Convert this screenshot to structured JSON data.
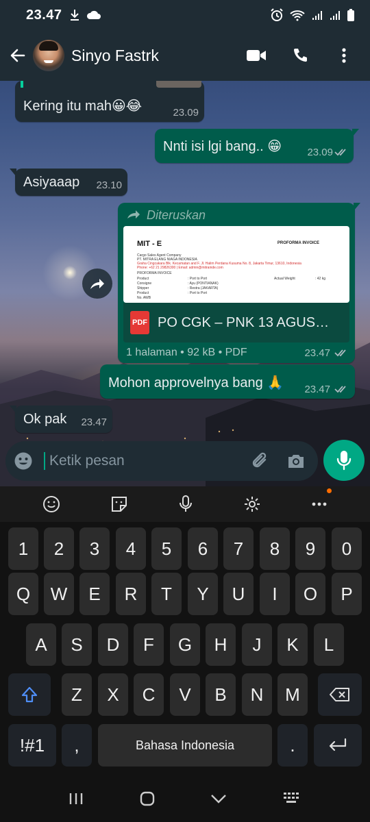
{
  "status_bar": {
    "time": "23.47"
  },
  "header": {
    "contact_name": "Sinyo Fastrk"
  },
  "messages": [
    {
      "direction": "in",
      "text": "Kering itu mah😀😂",
      "time": "23.09"
    },
    {
      "direction": "out",
      "text": "Nnti isi lgi bang.. 😁",
      "time": "23.09"
    },
    {
      "direction": "in",
      "text": "Asiyaaap",
      "time": "23.10"
    },
    {
      "direction": "out",
      "forwarded_label": "Diteruskan",
      "document": {
        "preview": {
          "company_logo": "MIT - E",
          "doc_heading": "PROFORMA INVOICE",
          "lines": [
            "Cargo Sales Agent Company",
            "PT. MITRA ELANG NIAGA INDONESIA",
            "Graha Cingcakara Blk. Kecamatan and F. Jl. Halim Perdana Kusuma No. 8, Jakarta Timur, 13610, Indonesia",
            "Phone: +62 21 29826300 | Email: admin@mitrainde.com",
            "PROFORMA INVOICE"
          ],
          "rows": [
            {
              "label": "Product",
              "value": ": Port to Port",
              "extra_label": "Actual Weight",
              "extra_value": ": 42 kg"
            },
            {
              "label": "Consigne",
              "value": ": Ayu (PONTIANAK)"
            },
            {
              "label": "Shipper",
              "value": ": Restra (JAKARTA)"
            },
            {
              "label": "Product",
              "value": ": Port to Port"
            },
            {
              "label": "No. AWB",
              "value": ""
            }
          ]
        },
        "badge": "PDF",
        "title": "PO CGK – PNK 13 AGUSTUS...",
        "meta": "1 halaman • 92 kB • PDF"
      },
      "time": "23.47"
    },
    {
      "direction": "out",
      "text": "Mohon approvelnya bang 🙏",
      "time": "23.47"
    },
    {
      "direction": "in",
      "text": "Ok pak",
      "time": "23.47"
    }
  ],
  "composer": {
    "placeholder": "Ketik pesan"
  },
  "keyboard": {
    "numbers": [
      "1",
      "2",
      "3",
      "4",
      "5",
      "6",
      "7",
      "8",
      "9",
      "0"
    ],
    "row1": [
      "Q",
      "W",
      "E",
      "R",
      "T",
      "Y",
      "U",
      "I",
      "O",
      "P"
    ],
    "row2": [
      "A",
      "S",
      "D",
      "F",
      "G",
      "H",
      "J",
      "K",
      "L"
    ],
    "row3": [
      "Z",
      "X",
      "C",
      "V",
      "B",
      "N",
      "M"
    ],
    "symbols_key": "!#1",
    "comma_key": ",",
    "space_key": "Bahasa Indonesia",
    "period_key": "."
  },
  "colors": {
    "accent": "#00a884",
    "incoming": "#1f2c34",
    "outgoing": "#005c4b"
  }
}
